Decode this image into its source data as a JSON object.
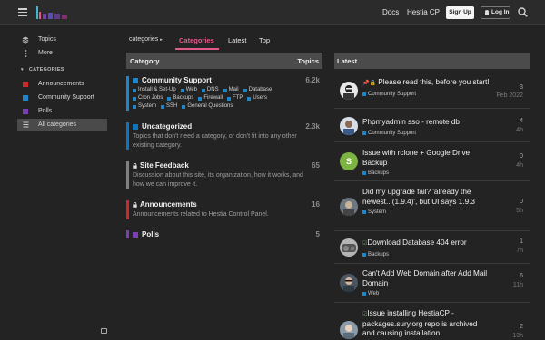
{
  "header": {
    "links": [
      "Docs",
      "Hestia CP"
    ],
    "signup_label": "Sign Up",
    "login_label": "Log In"
  },
  "sidebar": {
    "items": [
      {
        "label": "Topics",
        "icon": "layers-icon"
      },
      {
        "label": "More",
        "icon": "more-vertical-icon"
      }
    ],
    "categories_heading": "CATEGORIES",
    "categories": [
      {
        "label": "Announcements",
        "color": "#cc2a2a"
      },
      {
        "label": "Community Support",
        "color": "#1f86c9"
      },
      {
        "label": "Polls",
        "color": "#7a3fb3"
      },
      {
        "label": "All categories",
        "icon": "grid-icon"
      }
    ]
  },
  "nav": {
    "dropdown": "categories",
    "tabs": [
      "Categories",
      "Latest",
      "Top"
    ]
  },
  "category_table": {
    "col_category": "Category",
    "col_topics": "Topics",
    "rows": [
      {
        "title": "Community Support",
        "color": "#1f86c9",
        "count": "6.2k",
        "subs": [
          "Install & Set-Up",
          "Web",
          "DNS",
          "Mail",
          "Database",
          "Cron Jobs",
          "Backups",
          "Firewall",
          "FTP",
          "Users",
          "System",
          "SSH",
          "General Questions"
        ]
      },
      {
        "title": "Uncategorized",
        "color": "#0e76bd",
        "count": "2.3k",
        "desc": "Topics that don't need a category, or don't fit into any other existing category."
      },
      {
        "title": "Site Feedback",
        "color": "#808080",
        "count": "65",
        "desc": "Discussion about this site, its organization, how it works, and how we can improve it."
      },
      {
        "title": "Announcements",
        "color": "#cc2a2a",
        "count": "16",
        "desc": "Announcements related to Hestia Control Panel."
      },
      {
        "title": "Polls",
        "color": "#7a3fb3",
        "count": "5"
      }
    ]
  },
  "latest": {
    "heading": "Latest",
    "topics": [
      {
        "title": "Please read this, before you start!",
        "category": "Community Support",
        "cat_color": "#1f86c9",
        "replies": "3",
        "age": "Feb 2022"
      },
      {
        "title": "Phpmyadmin sso - remote db",
        "category": "Community Support",
        "cat_color": "#1f86c9",
        "replies": "4",
        "age": "4h"
      },
      {
        "title": "Issue with rclone + Google Drive Backup",
        "category": "Backups",
        "cat_color": "#1f86c9",
        "replies": "0",
        "age": "4h",
        "avatar_letter": "S"
      },
      {
        "title": "Did my upgrade fail? 'already the newest...(1.9.4)', but UI says 1.9.3",
        "category": "System",
        "cat_color": "#1f86c9",
        "replies": "0",
        "age": "5h"
      },
      {
        "title": "Download Database 404 error",
        "category": "Backups",
        "cat_color": "#1f86c9",
        "replies": "1",
        "age": "7h"
      },
      {
        "title": "Can't Add Web Domain after Add Mail Domain",
        "category": "Web",
        "cat_color": "#1f86c9",
        "replies": "6",
        "age": "11h"
      },
      {
        "title": "Issue installing HestiaCP - packages.sury.org repo is archived and causing installation",
        "category": "",
        "cat_color": "#1f86c9",
        "replies": "2",
        "age": "13h"
      }
    ]
  }
}
